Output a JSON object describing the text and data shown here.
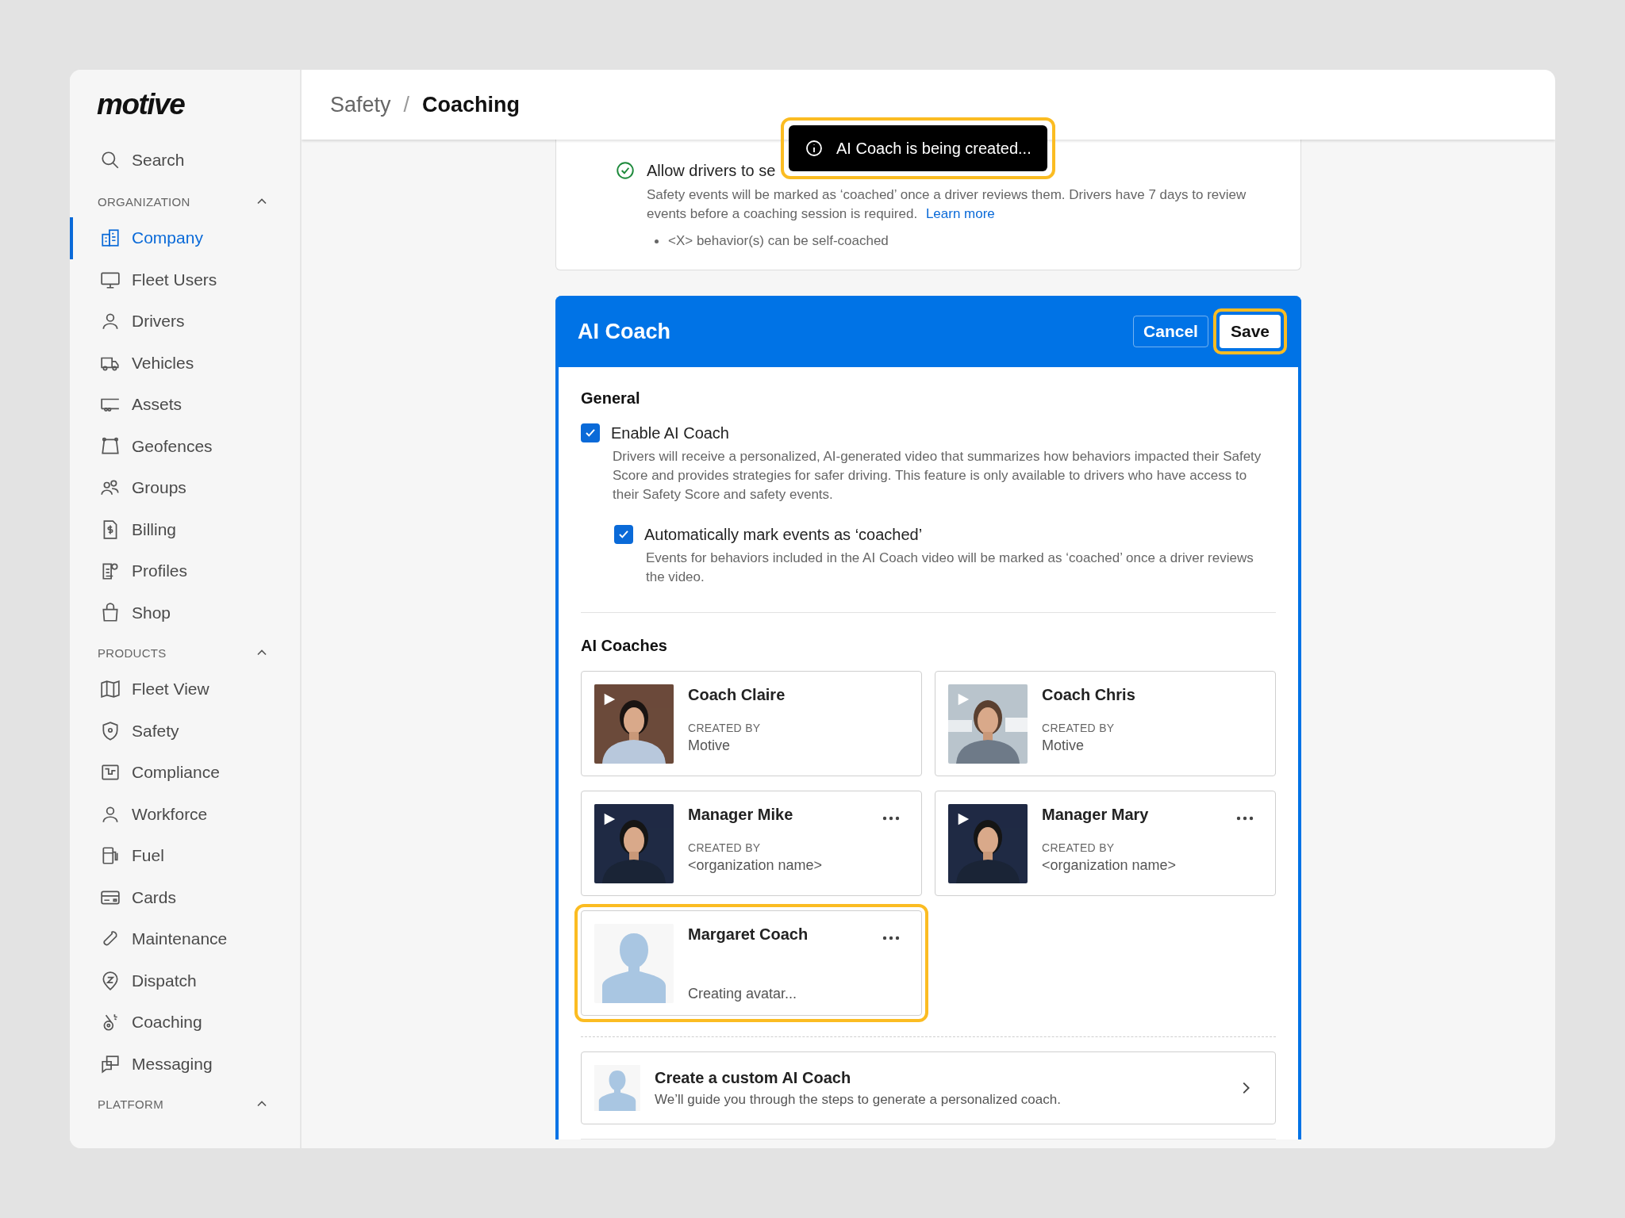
{
  "sidebar": {
    "logo": "motive",
    "search": "Search",
    "sections": [
      {
        "title": "ORGANIZATION",
        "expanded": true,
        "items": [
          {
            "label": "Company",
            "selected": true
          },
          {
            "label": "Fleet Users",
            "selected": false
          },
          {
            "label": "Drivers",
            "selected": false
          },
          {
            "label": "Vehicles",
            "selected": false
          },
          {
            "label": "Assets",
            "selected": false
          },
          {
            "label": "Geofences",
            "selected": false
          },
          {
            "label": "Groups",
            "selected": false
          },
          {
            "label": "Billing",
            "selected": false
          },
          {
            "label": "Profiles",
            "selected": false
          },
          {
            "label": "Shop",
            "selected": false
          }
        ]
      },
      {
        "title": "PRODUCTS",
        "expanded": true,
        "items": [
          {
            "label": "Fleet View",
            "selected": false
          },
          {
            "label": "Safety",
            "selected": false
          },
          {
            "label": "Compliance",
            "selected": false
          },
          {
            "label": "Workforce",
            "selected": false
          },
          {
            "label": "Fuel",
            "selected": false
          },
          {
            "label": "Cards",
            "selected": false
          },
          {
            "label": "Maintenance",
            "selected": false
          },
          {
            "label": "Dispatch",
            "selected": false
          },
          {
            "label": "Coaching",
            "selected": false
          },
          {
            "label": "Messaging",
            "selected": false
          }
        ]
      },
      {
        "title": "PLATFORM",
        "expanded": true
      }
    ]
  },
  "breadcrumb": {
    "items": [
      "Safety",
      "Coaching"
    ],
    "separator": "/"
  },
  "toast": {
    "text": "AI Coach is being created...",
    "highlighted": true
  },
  "self_coach": {
    "label": "Allow drivers to se",
    "checked": true,
    "description": "Safety events will be marked as ‘coached’ once a driver reviews them. Drivers have 7 days to review events before a coaching session is required.",
    "link": "Learn more",
    "bullet": "<X> behavior(s) can be self-coached"
  },
  "ai_coach": {
    "title": "AI Coach",
    "cancel": "Cancel",
    "save": {
      "label": "Save",
      "highlighted": true
    },
    "general_title": "General",
    "options": [
      {
        "label": "Enable AI Coach",
        "checked": true,
        "description": "Drivers will receive a personalized, AI-generated video that summarizes how behaviors impacted their Safety Score and provides strategies for safer driving. This feature is only available to drivers who have access to their Safety Score and safety events."
      },
      {
        "label": "Automatically mark events as ‘coached’",
        "checked": true,
        "description": "Events for behaviors included in the AI Coach video will be marked as ‘coached’ once a driver reviews the video."
      }
    ],
    "coaches_title": "AI Coaches",
    "coaches": [
      {
        "name": "Coach Claire",
        "kind": "video",
        "created_by_label": "CREATED BY",
        "created_by": "Motive",
        "menu": false,
        "highlighted": false
      },
      {
        "name": "Coach Chris",
        "kind": "video",
        "created_by_label": "CREATED BY",
        "created_by": "Motive",
        "menu": false,
        "highlighted": false
      },
      {
        "name": "Manager Mike",
        "kind": "video",
        "created_by_label": "CREATED BY",
        "created_by": "<organization name>",
        "menu": true,
        "highlighted": false
      },
      {
        "name": "Manager Mary",
        "kind": "video",
        "created_by_label": "CREATED BY",
        "created_by": "<organization name>",
        "menu": true,
        "highlighted": false
      },
      {
        "name": "Margaret Coach",
        "kind": "pending",
        "status": "Creating avatar...",
        "menu": true,
        "highlighted": true
      }
    ],
    "custom": {
      "title": "Create a custom AI Coach",
      "description": "We’ll guide you through the steps to generate a personalized coach."
    }
  }
}
